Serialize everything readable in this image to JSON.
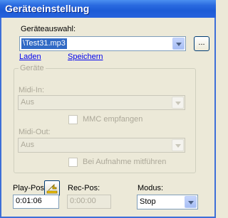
{
  "window": {
    "title": "Geräteeinstellung"
  },
  "device_selection": {
    "label": "Geräteauswahl:",
    "value": "\\Test31.mp3",
    "browse_label": "...",
    "load_link": "Laden",
    "save_link": "Speichern"
  },
  "devices_group": {
    "legend": "Geräte",
    "midi_in_label": "Midi-In:",
    "midi_in_value": "Aus",
    "mmc_label": "MMC empfangen",
    "mmc_checked": false,
    "midi_out_label": "Midi-Out:",
    "midi_out_value": "Aus",
    "record_label": "Bei Aufnahme mitführen",
    "record_checked": false
  },
  "positions": {
    "play_label": "Play-Pos:",
    "play_value": "0:01:06",
    "rec_label": "Rec-Pos:",
    "rec_value": "0:00:00",
    "mode_label": "Modus:",
    "mode_value": "Stop"
  },
  "colors": {
    "title_bar": "#2a6ae0",
    "selection": "#316ac5",
    "background": "#ece9d8"
  }
}
